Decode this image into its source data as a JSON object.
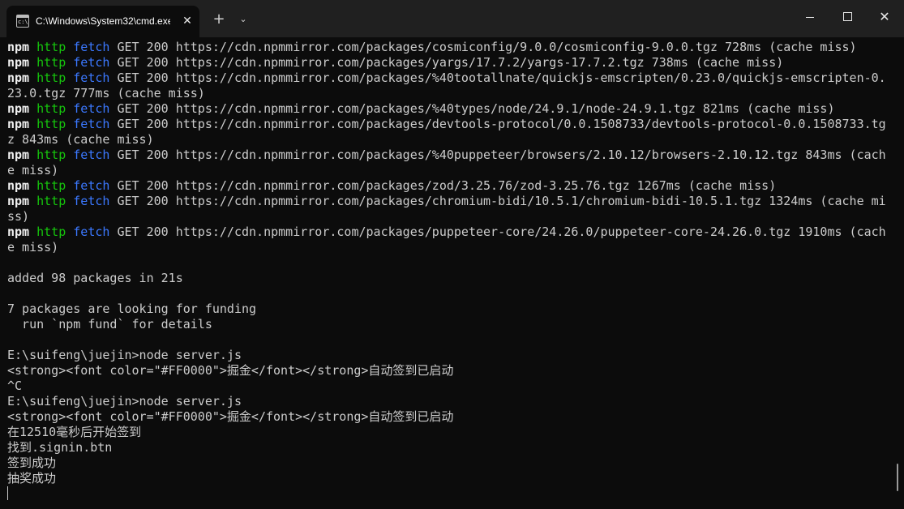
{
  "window": {
    "tab_title": "C:\\Windows\\System32\\cmd.exe",
    "tab_icon": "cmd-icon",
    "tab_close": "✕",
    "new_tab": "+",
    "dropdown": "⌄",
    "close": "✕"
  },
  "colors": {
    "background": "#0c0c0c",
    "titlebar": "#202020",
    "text": "#cccccc",
    "http": "#16c60c",
    "fetch": "#3b78ff"
  },
  "terminal": {
    "npm_lines": [
      {
        "tag1": "npm",
        "tag2": "http",
        "tag3": "fetch",
        "rest": " GET 200 https://cdn.npmmirror.com/packages/cosmiconfig/9.0.0/cosmiconfig-9.0.0.tgz 728ms (cache miss)"
      },
      {
        "tag1": "npm",
        "tag2": "http",
        "tag3": "fetch",
        "rest": " GET 200 https://cdn.npmmirror.com/packages/yargs/17.7.2/yargs-17.7.2.tgz 738ms (cache miss)"
      },
      {
        "tag1": "npm",
        "tag2": "http",
        "tag3": "fetch",
        "rest": " GET 200 https://cdn.npmmirror.com/packages/%40tootallnate/quickjs-emscripten/0.23.0/quickjs-emscripten-0.",
        "cont": "23.0.tgz 777ms (cache miss)"
      },
      {
        "tag1": "npm",
        "tag2": "http",
        "tag3": "fetch",
        "rest": " GET 200 https://cdn.npmmirror.com/packages/%40types/node/24.9.1/node-24.9.1.tgz 821ms (cache miss)"
      },
      {
        "tag1": "npm",
        "tag2": "http",
        "tag3": "fetch",
        "rest": " GET 200 https://cdn.npmmirror.com/packages/devtools-protocol/0.0.1508733/devtools-protocol-0.0.1508733.tg",
        "cont": "z 843ms (cache miss)"
      },
      {
        "tag1": "npm",
        "tag2": "http",
        "tag3": "fetch",
        "rest": " GET 200 https://cdn.npmmirror.com/packages/%40puppeteer/browsers/2.10.12/browsers-2.10.12.tgz 843ms (cach",
        "cont": "e miss)"
      },
      {
        "tag1": "npm",
        "tag2": "http",
        "tag3": "fetch",
        "rest": " GET 200 https://cdn.npmmirror.com/packages/zod/3.25.76/zod-3.25.76.tgz 1267ms (cache miss)"
      },
      {
        "tag1": "npm",
        "tag2": "http",
        "tag3": "fetch",
        "rest": " GET 200 https://cdn.npmmirror.com/packages/chromium-bidi/10.5.1/chromium-bidi-10.5.1.tgz 1324ms (cache mi",
        "cont": "ss)"
      },
      {
        "tag1": "npm",
        "tag2": "http",
        "tag3": "fetch",
        "rest": " GET 200 https://cdn.npmmirror.com/packages/puppeteer-core/24.26.0/puppeteer-core-24.26.0.tgz 1910ms (cach",
        "cont": "e miss)"
      }
    ],
    "output_lines": [
      "",
      "added 98 packages in 21s",
      "",
      "7 packages are looking for funding",
      "  run `npm fund` for details",
      "",
      "E:\\suifeng\\juejin>node server.js",
      "<strong><font color=\"#FF0000\">掘金</font></strong>自动签到已启动",
      "^C",
      "E:\\suifeng\\juejin>node server.js",
      "<strong><font color=\"#FF0000\">掘金</font></strong>自动签到已启动",
      "在12510毫秒后开始签到",
      "找到.signin.btn",
      "签到成功",
      "抽奖成功"
    ]
  }
}
